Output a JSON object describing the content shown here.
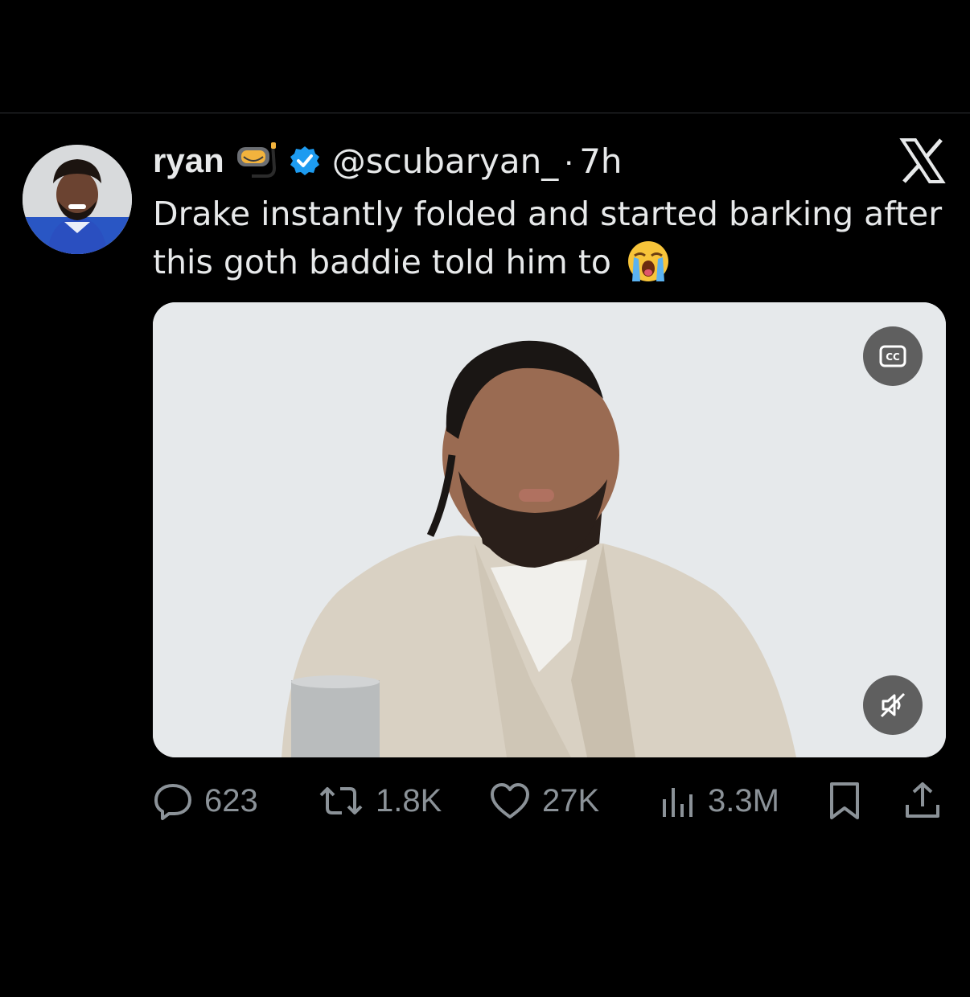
{
  "tweet": {
    "display_name": "ryan",
    "handle": "@scubaryan_",
    "separator": "·",
    "time": "7h",
    "text": "Drake instantly folded and started barking after this goth baddie told him to",
    "name_emoji": "diving-mask-icon",
    "text_emoji": "loudly-crying-face-icon"
  },
  "colors": {
    "background": "#000000",
    "text": "#e7e9ea",
    "muted": "#8b9298",
    "verified": "#1d9bf0"
  },
  "media": {
    "type": "video",
    "cc_icon": "closed-captions-icon",
    "mute_icon": "muted-speaker-icon"
  },
  "actions": {
    "replies": "623",
    "reposts": "1.8K",
    "likes": "27K",
    "views": "3.3M"
  }
}
